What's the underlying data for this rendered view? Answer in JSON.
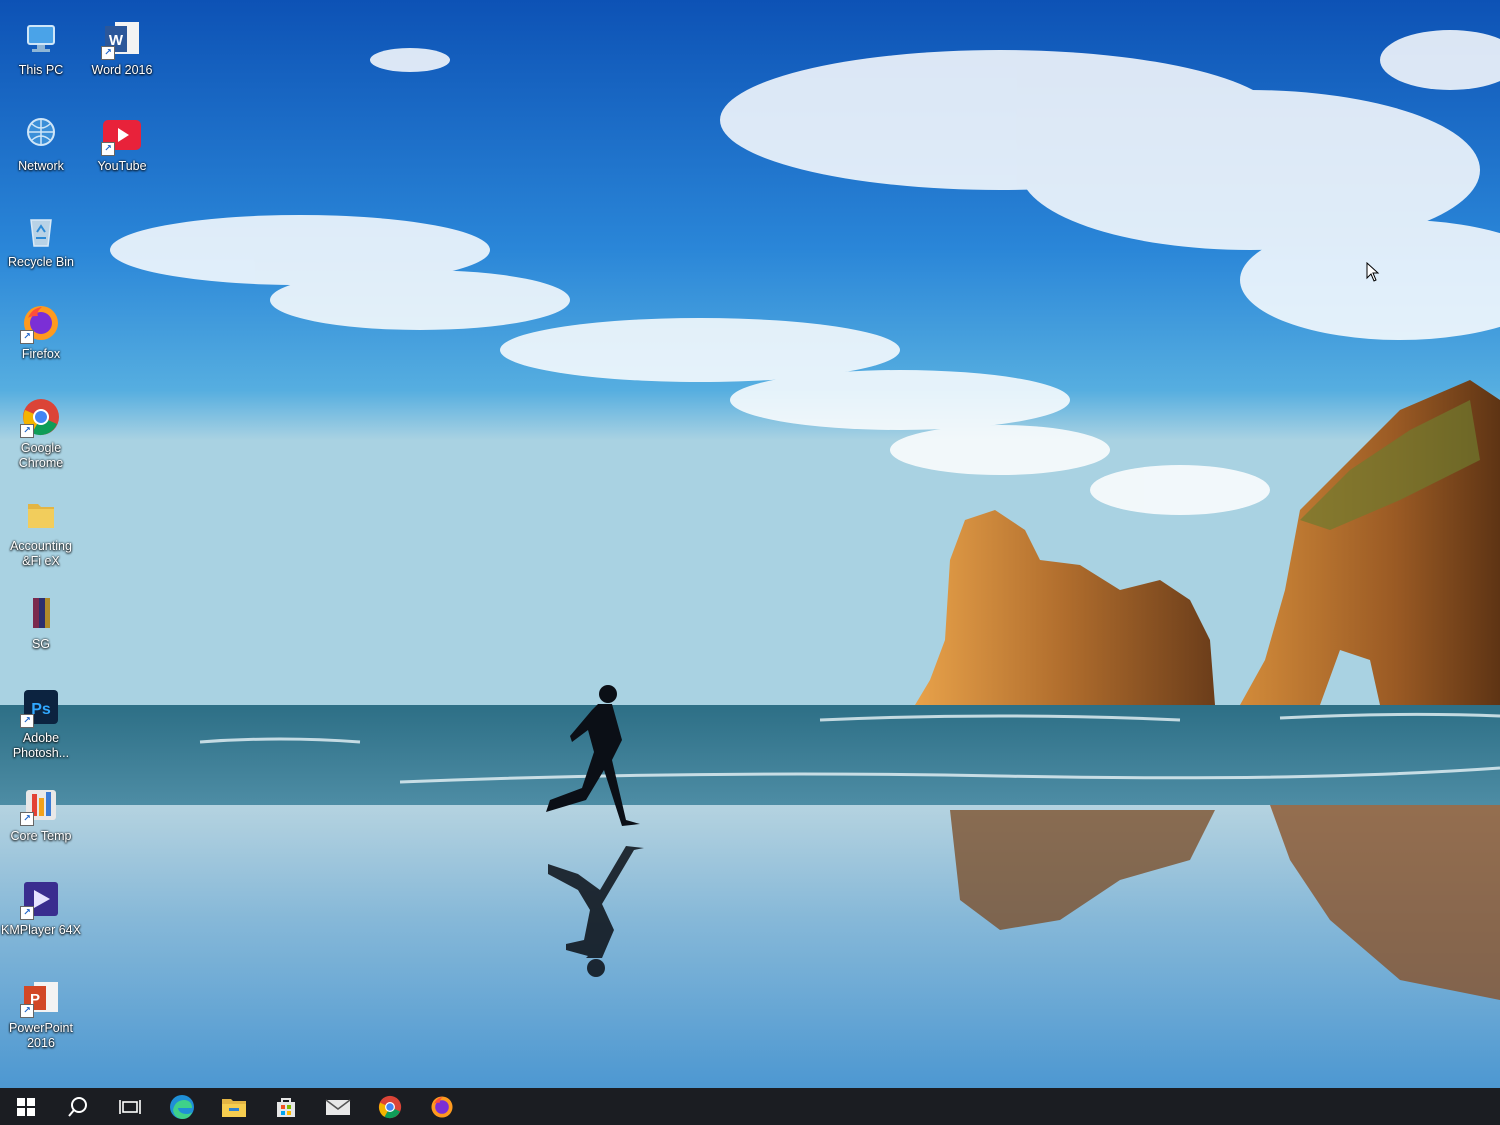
{
  "desktop": {
    "icons": [
      {
        "label": "This PC",
        "icon": "this-pc-icon"
      },
      {
        "label": "Word 2016",
        "icon": "word-icon"
      },
      {
        "label": "Network",
        "icon": "network-icon"
      },
      {
        "label": "YouTube",
        "icon": "youtube-icon"
      },
      {
        "label": "Recycle Bin",
        "icon": "recycle-bin-icon"
      },
      {
        "label": "Firefox",
        "icon": "firefox-icon"
      },
      {
        "label": "Google Chrome",
        "icon": "chrome-icon"
      },
      {
        "label": "Accounting &Fi eX",
        "icon": "folder-icon"
      },
      {
        "label": "SG",
        "icon": "sg-icon"
      },
      {
        "label": "Adobe Photosh...",
        "icon": "photoshop-icon"
      },
      {
        "label": "Core Temp",
        "icon": "core-temp-icon"
      },
      {
        "label": "KMPlayer 64X",
        "icon": "kmplayer-icon"
      },
      {
        "label": "PowerPoint 2016",
        "icon": "powerpoint-icon"
      }
    ]
  },
  "taskbar": {
    "items": [
      {
        "name": "start",
        "icon": "windows-start-icon"
      },
      {
        "name": "search",
        "icon": "search-icon"
      },
      {
        "name": "task-view",
        "icon": "task-view-icon"
      },
      {
        "name": "edge",
        "icon": "edge-icon"
      },
      {
        "name": "file-explorer",
        "icon": "file-explorer-icon"
      },
      {
        "name": "store",
        "icon": "store-icon"
      },
      {
        "name": "mail",
        "icon": "mail-icon"
      },
      {
        "name": "chrome",
        "icon": "chrome-icon"
      },
      {
        "name": "firefox",
        "icon": "firefox-icon"
      }
    ]
  },
  "colors": {
    "taskbar": "#1b1d22",
    "sky_top": "#0f55b8",
    "sand": "#9fc4dc"
  }
}
